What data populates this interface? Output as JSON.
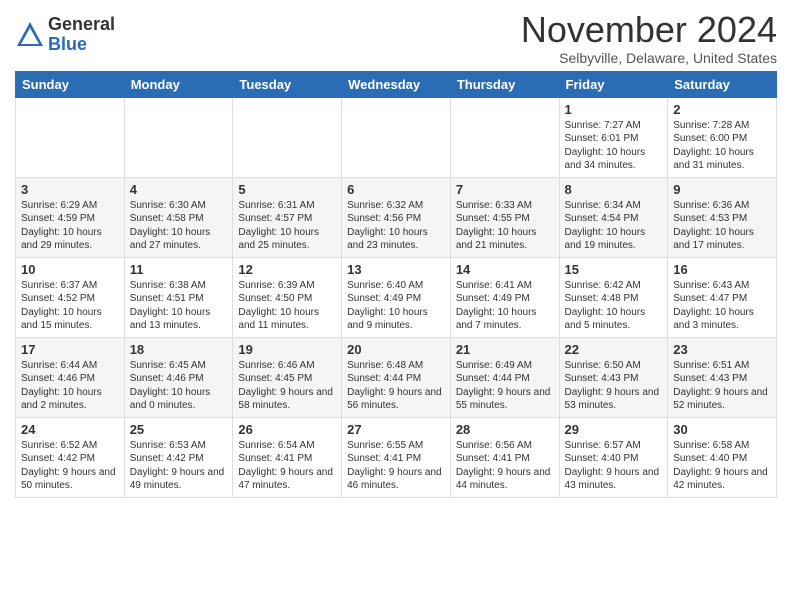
{
  "logo": {
    "general": "General",
    "blue": "Blue"
  },
  "title": "November 2024",
  "subtitle": "Selbyville, Delaware, United States",
  "headers": [
    "Sunday",
    "Monday",
    "Tuesday",
    "Wednesday",
    "Thursday",
    "Friday",
    "Saturday"
  ],
  "weeks": [
    [
      {
        "day": "",
        "info": ""
      },
      {
        "day": "",
        "info": ""
      },
      {
        "day": "",
        "info": ""
      },
      {
        "day": "",
        "info": ""
      },
      {
        "day": "",
        "info": ""
      },
      {
        "day": "1",
        "info": "Sunrise: 7:27 AM\nSunset: 6:01 PM\nDaylight: 10 hours\nand 34 minutes."
      },
      {
        "day": "2",
        "info": "Sunrise: 7:28 AM\nSunset: 6:00 PM\nDaylight: 10 hours\nand 31 minutes."
      }
    ],
    [
      {
        "day": "3",
        "info": "Sunrise: 6:29 AM\nSunset: 4:59 PM\nDaylight: 10 hours\nand 29 minutes."
      },
      {
        "day": "4",
        "info": "Sunrise: 6:30 AM\nSunset: 4:58 PM\nDaylight: 10 hours\nand 27 minutes."
      },
      {
        "day": "5",
        "info": "Sunrise: 6:31 AM\nSunset: 4:57 PM\nDaylight: 10 hours\nand 25 minutes."
      },
      {
        "day": "6",
        "info": "Sunrise: 6:32 AM\nSunset: 4:56 PM\nDaylight: 10 hours\nand 23 minutes."
      },
      {
        "day": "7",
        "info": "Sunrise: 6:33 AM\nSunset: 4:55 PM\nDaylight: 10 hours\nand 21 minutes."
      },
      {
        "day": "8",
        "info": "Sunrise: 6:34 AM\nSunset: 4:54 PM\nDaylight: 10 hours\nand 19 minutes."
      },
      {
        "day": "9",
        "info": "Sunrise: 6:36 AM\nSunset: 4:53 PM\nDaylight: 10 hours\nand 17 minutes."
      }
    ],
    [
      {
        "day": "10",
        "info": "Sunrise: 6:37 AM\nSunset: 4:52 PM\nDaylight: 10 hours\nand 15 minutes."
      },
      {
        "day": "11",
        "info": "Sunrise: 6:38 AM\nSunset: 4:51 PM\nDaylight: 10 hours\nand 13 minutes."
      },
      {
        "day": "12",
        "info": "Sunrise: 6:39 AM\nSunset: 4:50 PM\nDaylight: 10 hours\nand 11 minutes."
      },
      {
        "day": "13",
        "info": "Sunrise: 6:40 AM\nSunset: 4:49 PM\nDaylight: 10 hours\nand 9 minutes."
      },
      {
        "day": "14",
        "info": "Sunrise: 6:41 AM\nSunset: 4:49 PM\nDaylight: 10 hours\nand 7 minutes."
      },
      {
        "day": "15",
        "info": "Sunrise: 6:42 AM\nSunset: 4:48 PM\nDaylight: 10 hours\nand 5 minutes."
      },
      {
        "day": "16",
        "info": "Sunrise: 6:43 AM\nSunset: 4:47 PM\nDaylight: 10 hours\nand 3 minutes."
      }
    ],
    [
      {
        "day": "17",
        "info": "Sunrise: 6:44 AM\nSunset: 4:46 PM\nDaylight: 10 hours\nand 2 minutes."
      },
      {
        "day": "18",
        "info": "Sunrise: 6:45 AM\nSunset: 4:46 PM\nDaylight: 10 hours\nand 0 minutes."
      },
      {
        "day": "19",
        "info": "Sunrise: 6:46 AM\nSunset: 4:45 PM\nDaylight: 9 hours\nand 58 minutes."
      },
      {
        "day": "20",
        "info": "Sunrise: 6:48 AM\nSunset: 4:44 PM\nDaylight: 9 hours\nand 56 minutes."
      },
      {
        "day": "21",
        "info": "Sunrise: 6:49 AM\nSunset: 4:44 PM\nDaylight: 9 hours\nand 55 minutes."
      },
      {
        "day": "22",
        "info": "Sunrise: 6:50 AM\nSunset: 4:43 PM\nDaylight: 9 hours\nand 53 minutes."
      },
      {
        "day": "23",
        "info": "Sunrise: 6:51 AM\nSunset: 4:43 PM\nDaylight: 9 hours\nand 52 minutes."
      }
    ],
    [
      {
        "day": "24",
        "info": "Sunrise: 6:52 AM\nSunset: 4:42 PM\nDaylight: 9 hours\nand 50 minutes."
      },
      {
        "day": "25",
        "info": "Sunrise: 6:53 AM\nSunset: 4:42 PM\nDaylight: 9 hours\nand 49 minutes."
      },
      {
        "day": "26",
        "info": "Sunrise: 6:54 AM\nSunset: 4:41 PM\nDaylight: 9 hours\nand 47 minutes."
      },
      {
        "day": "27",
        "info": "Sunrise: 6:55 AM\nSunset: 4:41 PM\nDaylight: 9 hours\nand 46 minutes."
      },
      {
        "day": "28",
        "info": "Sunrise: 6:56 AM\nSunset: 4:41 PM\nDaylight: 9 hours\nand 44 minutes."
      },
      {
        "day": "29",
        "info": "Sunrise: 6:57 AM\nSunset: 4:40 PM\nDaylight: 9 hours\nand 43 minutes."
      },
      {
        "day": "30",
        "info": "Sunrise: 6:58 AM\nSunset: 4:40 PM\nDaylight: 9 hours\nand 42 minutes."
      }
    ]
  ]
}
